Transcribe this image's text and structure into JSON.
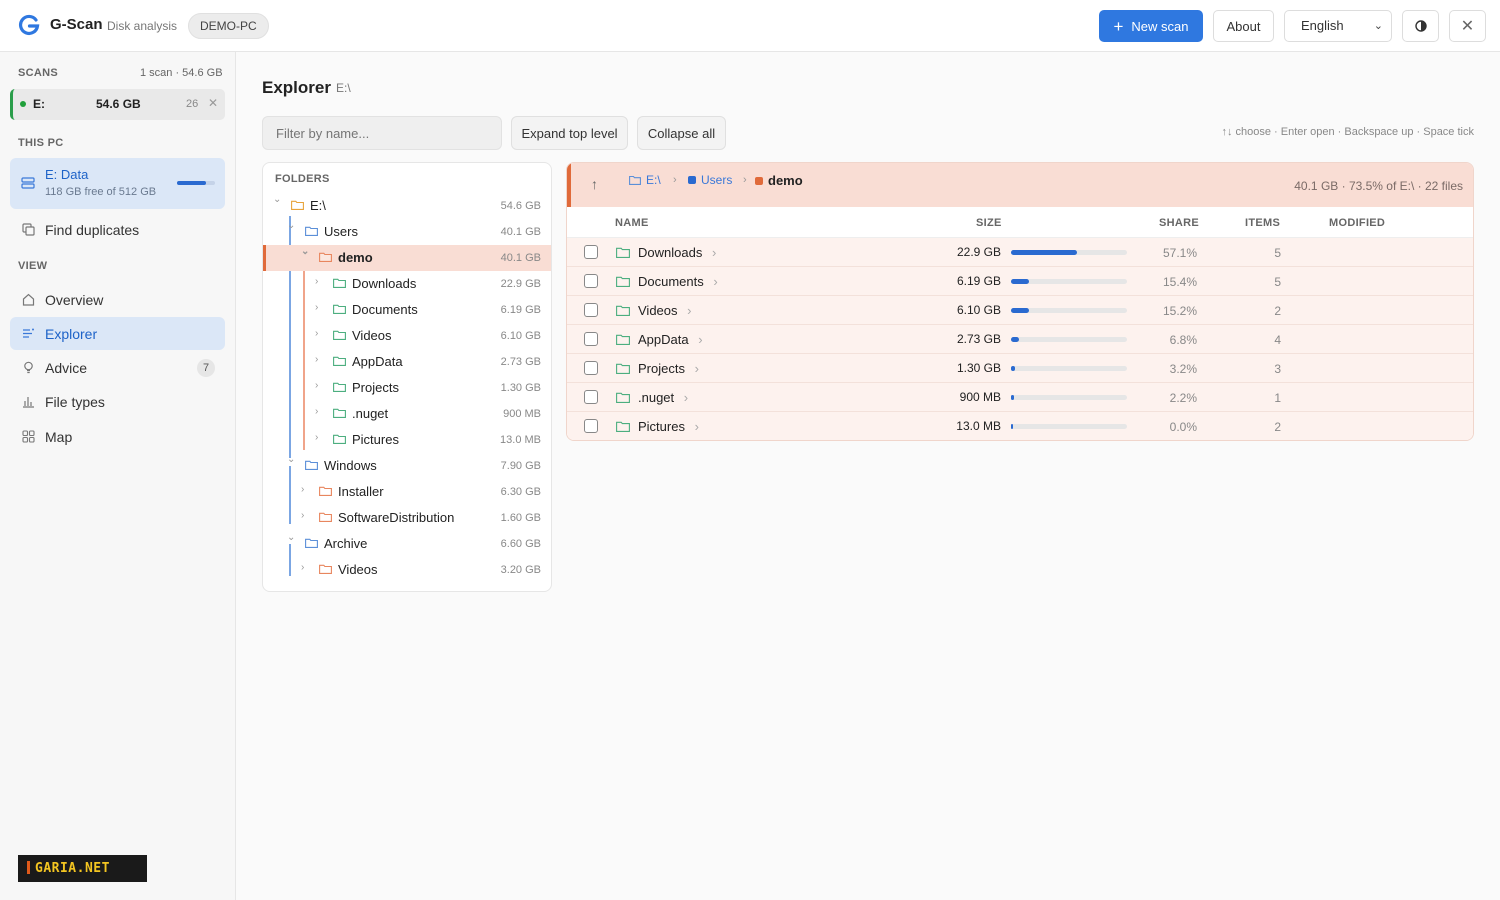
{
  "header": {
    "app_name": "G-Scan",
    "app_subtitle": "Disk analysis",
    "pc_name": "DEMO-PC",
    "new_scan_label": "New scan",
    "about_label": "About",
    "language": "English",
    "accent_color": "#2f78e0"
  },
  "sidebar": {
    "scans_label": "SCANS",
    "scans_summary": "1 scan · 54.6 GB",
    "scan": {
      "drive": "E:",
      "size": "54.6 GB",
      "count": "26"
    },
    "this_pc_label": "THIS PC",
    "drive": {
      "name": "E: Data",
      "free": "118 GB free of 512 GB",
      "used_fraction": 0.77
    },
    "find_duplicates_label": "Find duplicates",
    "view_label": "VIEW",
    "nav": [
      {
        "label": "Overview",
        "icon": "home-icon"
      },
      {
        "label": "Explorer",
        "icon": "list-icon",
        "active": true
      },
      {
        "label": "Advice",
        "icon": "lightbulb-icon",
        "badge": "7"
      },
      {
        "label": "File types",
        "icon": "bar-chart-icon"
      },
      {
        "label": "Map",
        "icon": "grid-icon"
      }
    ],
    "watermark": "GARIA.NET"
  },
  "main": {
    "title": "Explorer",
    "path": "E:\\",
    "filter_placeholder": "Filter by name...",
    "expand_label": "Expand top level",
    "collapse_label": "Collapse all",
    "hint": "↑↓ choose · Enter open · Backspace up · Space tick"
  },
  "tree": {
    "header": "FOLDERS",
    "rows": [
      {
        "name": "E:\\",
        "size": "54.6 GB",
        "depth": 0,
        "expanded": true
      },
      {
        "name": "Users",
        "size": "40.1 GB",
        "depth": 1,
        "expanded": true
      },
      {
        "name": "demo",
        "size": "40.1 GB",
        "depth": 2,
        "expanded": true,
        "selected": true
      },
      {
        "name": "Downloads",
        "size": "22.9 GB",
        "depth": 3
      },
      {
        "name": "Documents",
        "size": "6.19 GB",
        "depth": 3
      },
      {
        "name": "Videos",
        "size": "6.10 GB",
        "depth": 3
      },
      {
        "name": "AppData",
        "size": "2.73 GB",
        "depth": 3
      },
      {
        "name": "Projects",
        "size": "1.30 GB",
        "depth": 3
      },
      {
        "name": ".nuget",
        "size": "900 MB",
        "depth": 3
      },
      {
        "name": "Pictures",
        "size": "13.0 MB",
        "depth": 3
      },
      {
        "name": "Windows",
        "size": "7.90 GB",
        "depth": 1,
        "expanded": true
      },
      {
        "name": "Installer",
        "size": "6.30 GB",
        "depth": 2
      },
      {
        "name": "SoftwareDistribution",
        "size": "1.60 GB",
        "depth": 2
      },
      {
        "name": "Archive",
        "size": "6.60 GB",
        "depth": 1,
        "expanded": true
      },
      {
        "name": "Videos",
        "size": "3.20 GB",
        "depth": 2
      }
    ]
  },
  "table": {
    "breadcrumb": [
      {
        "label": "E:\\"
      },
      {
        "label": "Users"
      },
      {
        "label": "demo"
      }
    ],
    "stats": "40.1 GB · 73.5% of E:\\ · 22 files",
    "columns": {
      "name": "NAME",
      "size": "SIZE",
      "share": "SHARE",
      "items": "ITEMS",
      "modified": "MODIFIED"
    },
    "rows": [
      {
        "name": "Downloads",
        "size": "22.9 GB",
        "share": "57.1%",
        "share_value": 0.571,
        "items": "5"
      },
      {
        "name": "Documents",
        "size": "6.19 GB",
        "share": "15.4%",
        "share_value": 0.154,
        "items": "5"
      },
      {
        "name": "Videos",
        "size": "6.10 GB",
        "share": "15.2%",
        "share_value": 0.152,
        "items": "2"
      },
      {
        "name": "AppData",
        "size": "2.73 GB",
        "share": "6.8%",
        "share_value": 0.068,
        "items": "4"
      },
      {
        "name": "Projects",
        "size": "1.30 GB",
        "share": "3.2%",
        "share_value": 0.032,
        "items": "3"
      },
      {
        "name": ".nuget",
        "size": "900 MB",
        "share": "2.2%",
        "share_value": 0.022,
        "items": "1"
      },
      {
        "name": "Pictures",
        "size": "13.0 MB",
        "share": "0.0%",
        "share_value": 0.0,
        "items": "2"
      }
    ]
  }
}
